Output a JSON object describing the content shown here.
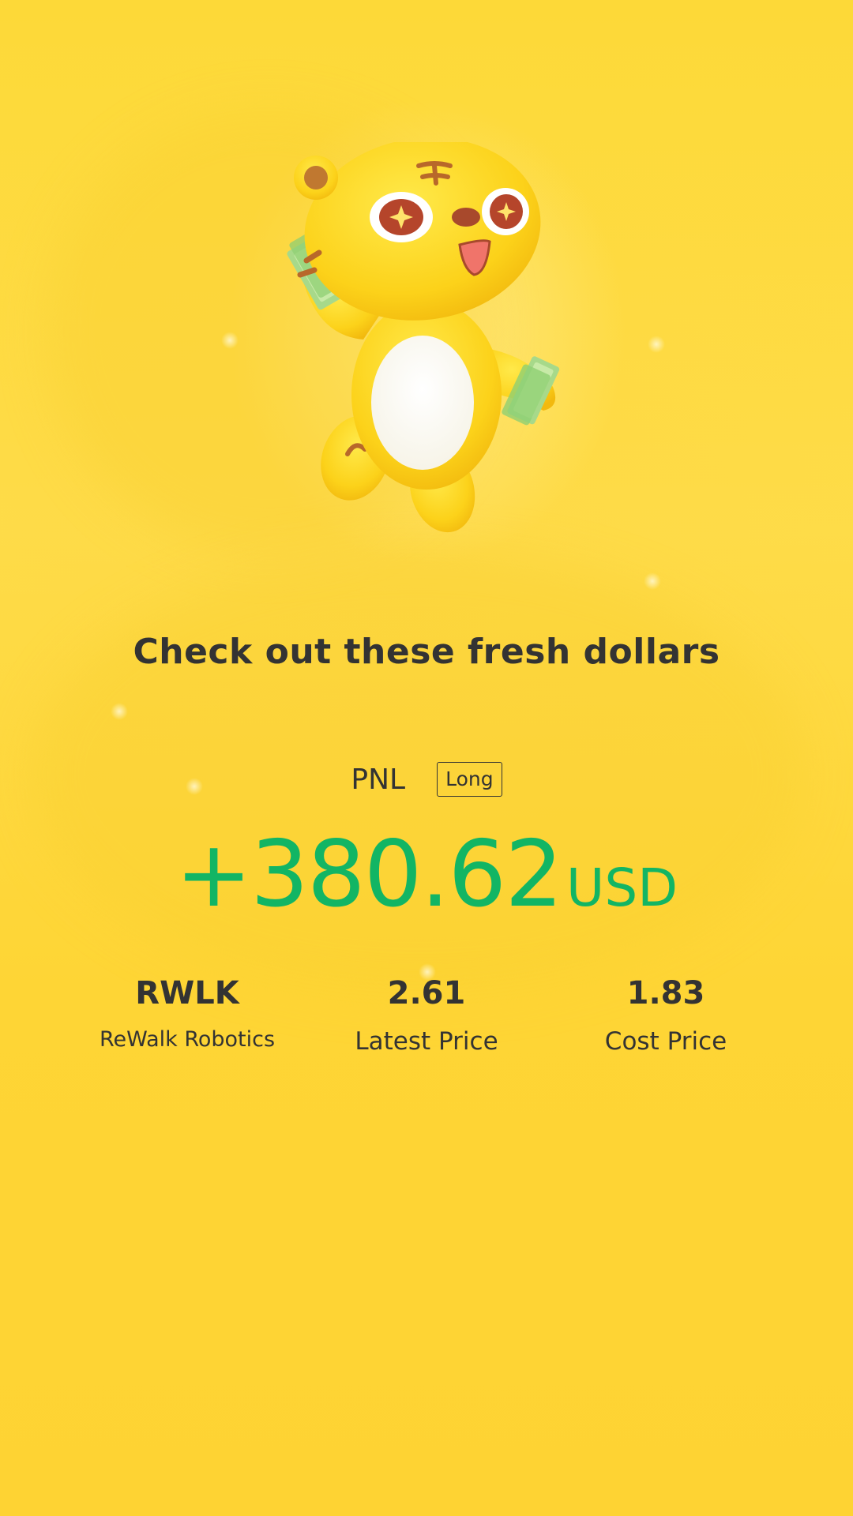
{
  "headline": "Check out these fresh dollars",
  "pnl": {
    "label": "PNL",
    "direction": "Long",
    "value": "+380.62",
    "currency": "USD"
  },
  "stats": [
    {
      "value": "RWLK",
      "label": "ReWalk Robotics"
    },
    {
      "value": "2.61",
      "label": "Latest Price"
    },
    {
      "value": "1.83",
      "label": "Cost Price"
    }
  ],
  "colors": {
    "background": "#fed531",
    "profit_green": "#12b564",
    "text_dark": "#333333"
  },
  "mascot": "yellow-tiger-mascot-holding-cash"
}
